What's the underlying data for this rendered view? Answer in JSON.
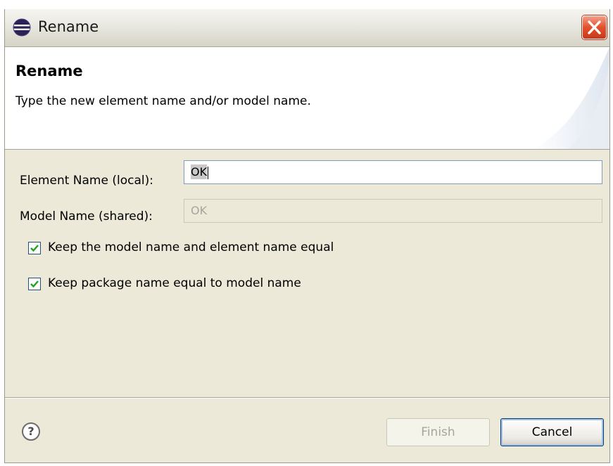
{
  "window": {
    "title": "Rename"
  },
  "banner": {
    "title": "Rename",
    "description": "Type the new element name and/or model name."
  },
  "form": {
    "element_name_label": "Element Name (local):",
    "element_name_value": "OK",
    "model_name_label": "Model Name (shared):",
    "model_name_value": "OK"
  },
  "options": {
    "keep_equal_label": "Keep the model name and element name equal",
    "keep_equal_checked": true,
    "keep_package_label": "Keep package name equal to model name",
    "keep_package_checked": true
  },
  "buttons": {
    "finish_label": "Finish",
    "finish_enabled": false,
    "cancel_label": "Cancel",
    "help_symbol": "?"
  },
  "icons": {
    "app": "eclipse-icon",
    "close": "close-icon",
    "help": "help-icon",
    "check": "check-icon"
  },
  "colors": {
    "dialog_bg": "#ece9d8",
    "close_red": "#e3502c",
    "checkmark_green": "#21a121",
    "field_border": "#7f9db9"
  }
}
